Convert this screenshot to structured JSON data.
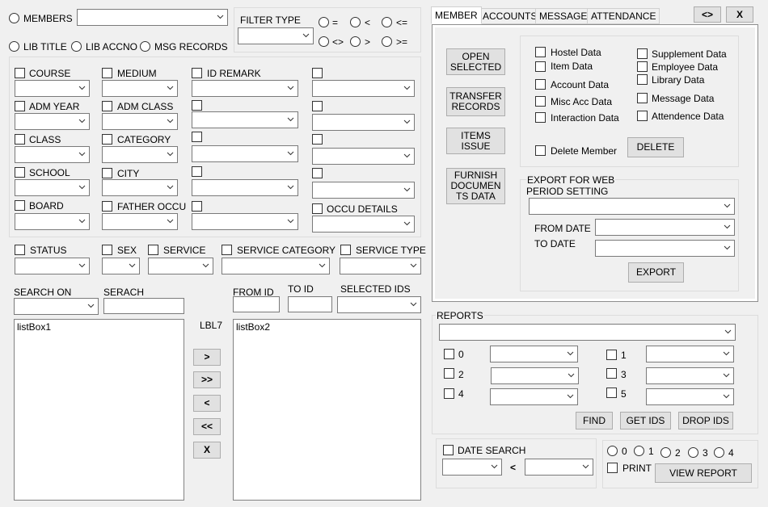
{
  "top": {
    "members": "MEMBERS",
    "lib_title": "LIB TITLE",
    "lib_accno": "LIB ACCNO",
    "msg_records": "MSG RECORDS",
    "filter_type": "FILTER TYPE",
    "ops": [
      "=",
      "<",
      "<=",
      "<>",
      ">",
      ">="
    ]
  },
  "filters": {
    "col1": [
      "COURSE",
      "ADM YEAR",
      "CLASS",
      "SCHOOL",
      "BOARD"
    ],
    "col2": [
      "MEDIUM",
      "ADM CLASS",
      "CATEGORY",
      "CITY",
      "FATHER OCCU"
    ],
    "col3": [
      "ID REMARK"
    ],
    "occu_details": "OCCU DETAILS"
  },
  "status_row": [
    "STATUS",
    "SEX",
    "SERVICE",
    "SERVICE CATEGORY",
    "SERVICE TYPE"
  ],
  "search": {
    "search_on": "SEARCH ON",
    "serach": "SERACH",
    "from_id": "FROM ID",
    "to_id": "TO ID",
    "selected_ids": "SELECTED IDS",
    "lbl7": "LBL7",
    "listbox1": "listBox1",
    "listbox2": "listBox2",
    "move_buttons": [
      ">",
      ">>",
      "<",
      "<<",
      "X"
    ]
  },
  "window_buttons": {
    "toggle": "<>",
    "close": "X"
  },
  "tabs": [
    "MEMBER",
    "ACCOUNTS",
    "MESSAGE",
    "ATTENDANCE"
  ],
  "member_tab": {
    "buttons": [
      "OPEN SELECTED",
      "TRANSFER RECORDS",
      "ITEMS ISSUE",
      "FURNISH DOCUMEN TS DATA"
    ],
    "data_left": [
      "Hostel Data",
      "Item Data",
      "Account Data",
      "Misc Acc Data",
      "Interaction Data"
    ],
    "data_right": [
      "Supplement Data",
      "Employee Data",
      "Library Data",
      "Message Data",
      "Attendence Data"
    ],
    "delete_member": "Delete Member",
    "delete": "DELETE",
    "export_title": "EXPORT FOR WEB",
    "period_setting": "PERIOD SETTING",
    "from_date": "FROM DATE",
    "to_date": "TO DATE",
    "export": "EXPORT"
  },
  "reports": {
    "title": "REPORTS",
    "checks": [
      "0",
      "1",
      "2",
      "3",
      "4",
      "5"
    ],
    "find": "FIND",
    "get_ids": "GET IDS",
    "drop_ids": "DROP IDS",
    "date_search": "DATE SEARCH",
    "lt": "<",
    "radios": [
      "0",
      "1",
      "2",
      "3",
      "4"
    ],
    "print": "PRINT",
    "view_report": "VIEW REPORT"
  }
}
